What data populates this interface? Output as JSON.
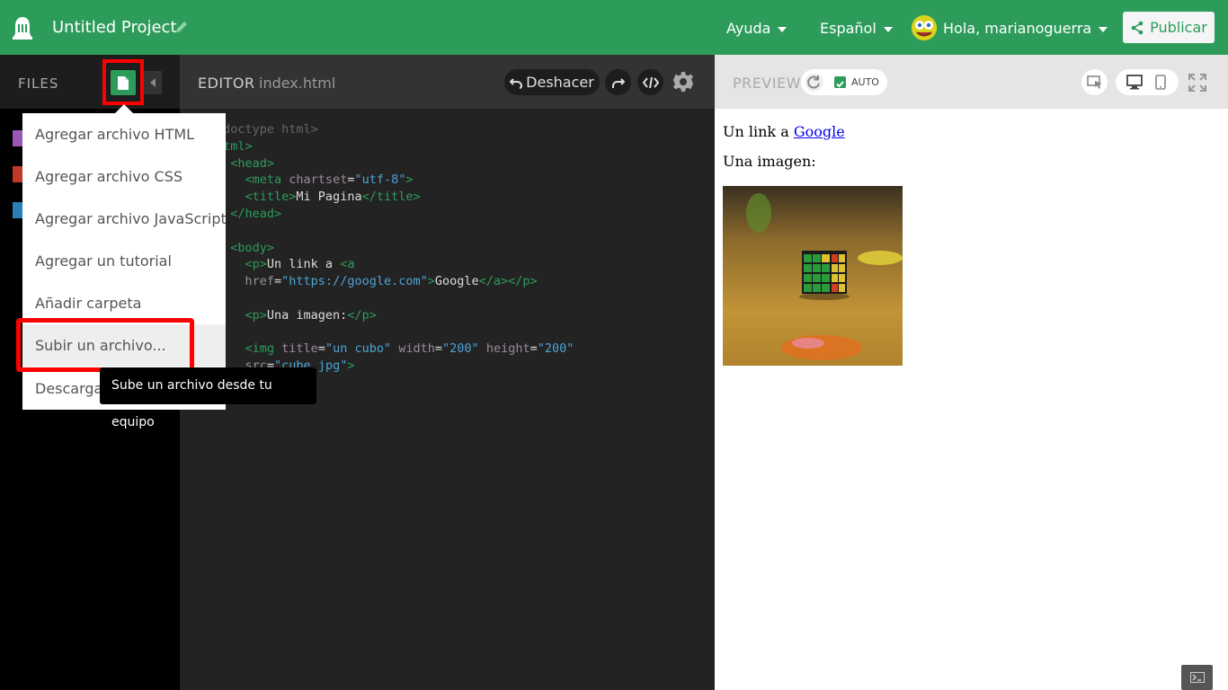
{
  "topbar": {
    "project_title": "Untitled Project",
    "help_label": "Ayuda",
    "language_label": "Español",
    "user_greeting": "Hola, marianoguerra",
    "publish_label": "Publicar"
  },
  "files": {
    "label": "FILES"
  },
  "menu": {
    "items": [
      "Agregar archivo HTML",
      "Agregar archivo CSS",
      "Agregar archivo JavaScript",
      "Agregar un tutorial",
      "Añadir carpeta",
      "Subir un archivo...",
      "Descargar"
    ],
    "tooltip": "Sube un archivo desde tu equipo"
  },
  "editor": {
    "label": "EDITOR",
    "filename": "index.html",
    "undo_label": "Deshacer"
  },
  "code": {
    "doctype": "!doctype html>",
    "html_open": "html>",
    "head_open": "<head>",
    "meta_tag": "<meta",
    "meta_attr": "chartset",
    "meta_value": "\"utf-8\"",
    "title_open": "<title>",
    "title_text": "Mi Pagina",
    "title_close": "</title>",
    "head_close": "</head>",
    "body_open": "<body>",
    "p1_open": "<p>",
    "p1_text": "Un link a ",
    "a_open": "<a",
    "href_attr": "href",
    "href_value": "\"https://google.com\"",
    "a_text": "Google",
    "a_close": "</a></p>",
    "p2_open": "<p>",
    "p2_text": "Una imagen:",
    "p2_close": "</p>",
    "img_open": "<img",
    "img_title_attr": "title",
    "img_title_value": "\"un cubo\"",
    "img_width_attr": "width",
    "img_width_value": "\"200\"",
    "img_height_attr": "height",
    "img_height_value": "\"200\"",
    "img_src_attr": "src",
    "img_src_value": "\"cube.jpg\"",
    "img_close": ">"
  },
  "preview": {
    "label": "PREVIEW",
    "auto_label": "AUTO",
    "link_prefix": "Un link a",
    "link_text": "Google",
    "image_caption": "Una imagen:"
  },
  "colors": {
    "brand": "#2d9c5b",
    "highlight": "#ff0000"
  }
}
